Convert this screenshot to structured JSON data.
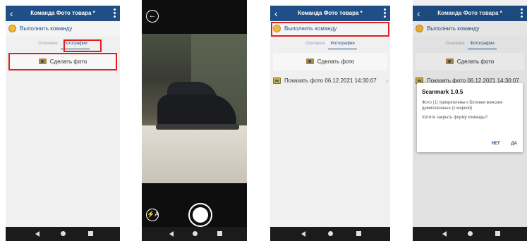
{
  "screen_title": "Команда Фото товара *",
  "run_command": "Выполнить команду",
  "tabs": {
    "main": "Основное",
    "photos": "Фотографии"
  },
  "take_photo": "Сделать фото",
  "show_photo": "Показать фото 06.12.2021 14:30:07",
  "show_photo_cut": "Показать фото 06.12.2021 14:30:07",
  "flash_glyph": "⚡A",
  "dialog": {
    "title": "Scanmark 1.0.5",
    "message": "Фото (1) прикреплены к Ботинки женские демисезонные (с маркой)",
    "question": "Хотите закрыть форму команды?",
    "no": "НЕТ",
    "yes": "ДА"
  },
  "colors": {
    "titlebar": "#1f4f86",
    "highlight": "#e02020",
    "navbar": "#1b1b1b"
  },
  "icons": {
    "back": "chevron-left-icon",
    "menu": "more-vert-icon",
    "camera": "camera-icon",
    "photo": "image-file-icon"
  }
}
